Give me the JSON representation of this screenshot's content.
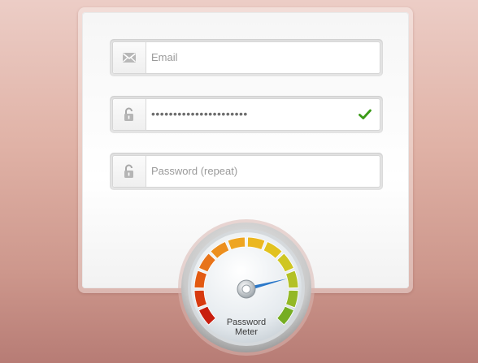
{
  "form": {
    "email": {
      "placeholder": "Email",
      "value": ""
    },
    "password": {
      "value": "••••••••••••••••••••••",
      "valid": true
    },
    "password_repeat": {
      "placeholder": "Password (repeat)",
      "value": ""
    }
  },
  "icons": {
    "email": "envelope-icon",
    "password": "unlock-icon",
    "password_repeat": "unlock-icon",
    "valid": "checkmark-icon"
  },
  "meter": {
    "label_line1": "Password",
    "label_line2": "Meter",
    "level": 0.78
  },
  "colors": {
    "check": "#3a9a16",
    "needle": "#2b78c9",
    "scale_low": "#d22410",
    "scale_mid": "#e8b51a",
    "scale_high": "#7cb421"
  }
}
